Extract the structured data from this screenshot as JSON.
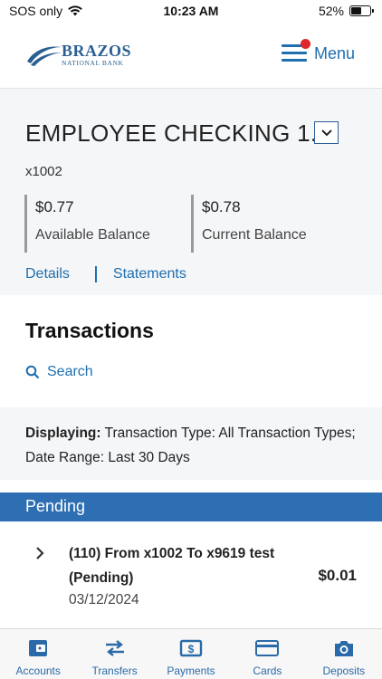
{
  "status_bar": {
    "carrier": "SOS only",
    "time": "10:23 AM",
    "battery_label": "52%",
    "battery_level": 0.52
  },
  "header": {
    "logo_name": "BRAZOS",
    "logo_subtitle": "NATIONAL BANK",
    "menu_label": "Menu",
    "notification_dot": true
  },
  "account": {
    "title": "EMPLOYEE CHECKING 1...",
    "number": "x1002",
    "available_balance": {
      "amount": "$0.77",
      "label": "Available Balance"
    },
    "current_balance": {
      "amount": "$0.78",
      "label": "Current Balance"
    },
    "links": {
      "details": "Details",
      "statements": "Statements"
    }
  },
  "transactions": {
    "heading": "Transactions",
    "search_label": "Search",
    "displaying_label": "Displaying:",
    "displaying_text": " Transaction Type: All Transaction Types; Date Range: Last 30 Days",
    "pending_label": "Pending",
    "items": [
      {
        "description": "(110) From x1002 To x9619 test (Pending)",
        "date": "03/12/2024",
        "amount": "$0.01"
      }
    ]
  },
  "tabbar": {
    "tabs": [
      {
        "label": "Accounts",
        "icon": "wallet-icon"
      },
      {
        "label": "Transfers",
        "icon": "transfer-arrows-icon"
      },
      {
        "label": "Payments",
        "icon": "dollar-bill-icon"
      },
      {
        "label": "Cards",
        "icon": "credit-card-icon"
      },
      {
        "label": "Deposits",
        "icon": "camera-icon"
      }
    ]
  },
  "colors": {
    "brand_blue": "#1f6fb0",
    "pending_bar": "#2e6fb3",
    "notification_red": "#e0262b",
    "panel_bg": "#f5f6f8"
  }
}
